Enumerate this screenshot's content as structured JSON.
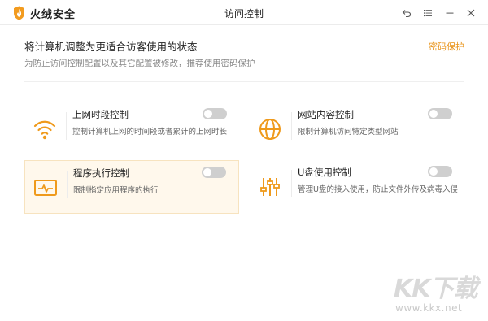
{
  "app": {
    "brand": "火绒安全",
    "window_title": "访问控制"
  },
  "header": {
    "heading": "将计算机调整为更适合访客使用的状态",
    "subheading": "为防止访问控制配置以及其它配置被修改，推荐使用密码保护",
    "password_link": "密码保护"
  },
  "cards": [
    {
      "title": "上网时段控制",
      "desc": "控制计算机上网的时间段或者累计的上网时长",
      "icon": "wifi-icon",
      "enabled": false
    },
    {
      "title": "网站内容控制",
      "desc": "限制计算机访问特定类型网站",
      "icon": "globe-icon",
      "enabled": false
    },
    {
      "title": "程序执行控制",
      "desc": "限制指定应用程序的执行",
      "icon": "monitor-pulse-icon",
      "enabled": false
    },
    {
      "title": "U盘使用控制",
      "desc": "管理U盘的接入使用，防止文件外传及病毒入侵",
      "icon": "sliders-icon",
      "enabled": false
    }
  ],
  "watermark": {
    "big": "KK下载",
    "small": "www.kkx.net"
  },
  "colors": {
    "accent": "#e8941b",
    "toggle_off": "#cfcfcf",
    "selected_bg": "#fff8ec"
  }
}
